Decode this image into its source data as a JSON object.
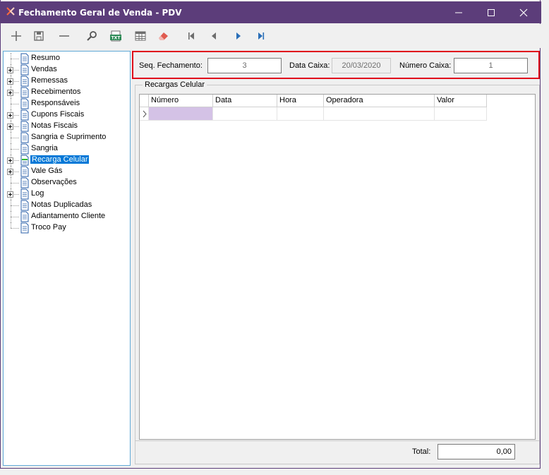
{
  "window": {
    "title": "Fechamento Geral de Venda - PDV",
    "accent_color": "#5c3d7a"
  },
  "toolbar": {
    "buttons": [
      {
        "icon": "plus-icon"
      },
      {
        "icon": "save-icon"
      },
      {
        "icon": "minus-icon"
      },
      {
        "icon": "search-icon"
      },
      {
        "icon": "txt-export-icon",
        "text": "TXT"
      },
      {
        "icon": "grid-icon"
      },
      {
        "icon": "eraser-icon"
      },
      {
        "icon": "first-record-icon"
      },
      {
        "icon": "previous-record-icon"
      },
      {
        "icon": "next-record-icon"
      },
      {
        "icon": "last-record-icon"
      }
    ]
  },
  "tree": {
    "items": [
      {
        "label": "Resumo",
        "expandable": false
      },
      {
        "label": "Vendas",
        "expandable": true
      },
      {
        "label": "Remessas",
        "expandable": true
      },
      {
        "label": "Recebimentos",
        "expandable": true
      },
      {
        "label": "Responsáveis",
        "expandable": false
      },
      {
        "label": "Cupons Fiscais",
        "expandable": true
      },
      {
        "label": "Notas Fiscais",
        "expandable": true
      },
      {
        "label": "Sangria e Suprimento",
        "expandable": false
      },
      {
        "label": "Sangria",
        "expandable": false
      },
      {
        "label": "Recarga Celular",
        "expandable": true,
        "selected": true
      },
      {
        "label": "Vale Gás",
        "expandable": true
      },
      {
        "label": "Observações",
        "expandable": false
      },
      {
        "label": "Log",
        "expandable": true
      },
      {
        "label": "Notas Duplicadas",
        "expandable": false
      },
      {
        "label": "Adiantamento Cliente",
        "expandable": false
      },
      {
        "label": "Troco Pay",
        "expandable": false
      }
    ]
  },
  "header": {
    "seq_label": "Seq. Fechamento:",
    "seq_value": "3",
    "data_label": "Data Caixa:",
    "data_value": "20/03/2020",
    "numero_label": "Número Caixa:",
    "numero_value": "1"
  },
  "group": {
    "title": "Recargas Celular"
  },
  "grid": {
    "columns": [
      "Número",
      "Data",
      "Hora",
      "Operadora",
      "Valor"
    ]
  },
  "footer": {
    "total_label": "Total:",
    "total_value": "0,00"
  }
}
